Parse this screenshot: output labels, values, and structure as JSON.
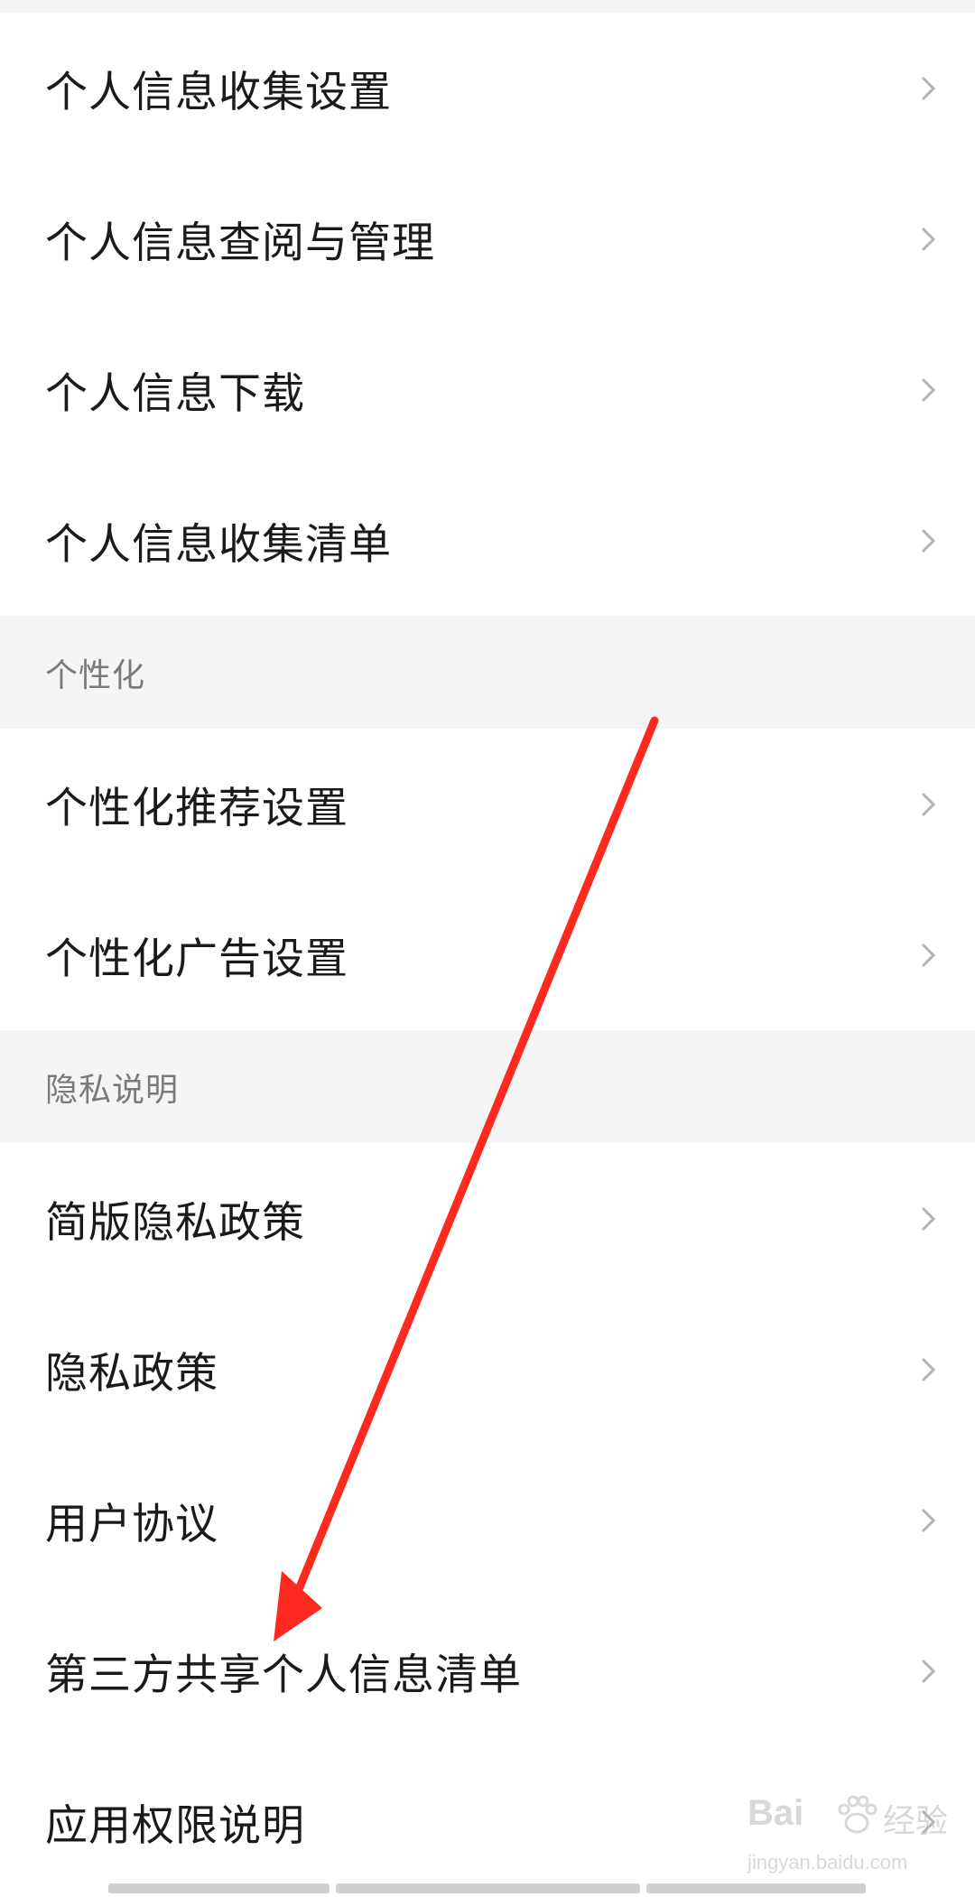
{
  "groups": [
    {
      "items": [
        {
          "label": "个人信息收集设置"
        },
        {
          "label": "个人信息查阅与管理"
        },
        {
          "label": "个人信息下载"
        },
        {
          "label": "个人信息收集清单"
        }
      ]
    },
    {
      "header": "个性化",
      "items": [
        {
          "label": "个性化推荐设置"
        },
        {
          "label": "个性化广告设置"
        }
      ]
    },
    {
      "header": "隐私说明",
      "items": [
        {
          "label": "简版隐私政策"
        },
        {
          "label": "隐私政策"
        },
        {
          "label": "用户协议"
        },
        {
          "label": "第三方共享个人信息清单"
        },
        {
          "label": "应用权限说明"
        }
      ]
    }
  ],
  "annotation": {
    "arrow_color": "#ff2a1f"
  },
  "watermark": {
    "logo": "Bai",
    "brand_cn": "经验",
    "url": "jingyan.baidu.com"
  },
  "colors": {
    "row_text": "#1a1a1a",
    "section_text": "#7a7a7a",
    "chevron": "#b3b3b3",
    "background": "#f5f5f5"
  },
  "icons": {
    "chevron": "chevron-right-icon"
  }
}
